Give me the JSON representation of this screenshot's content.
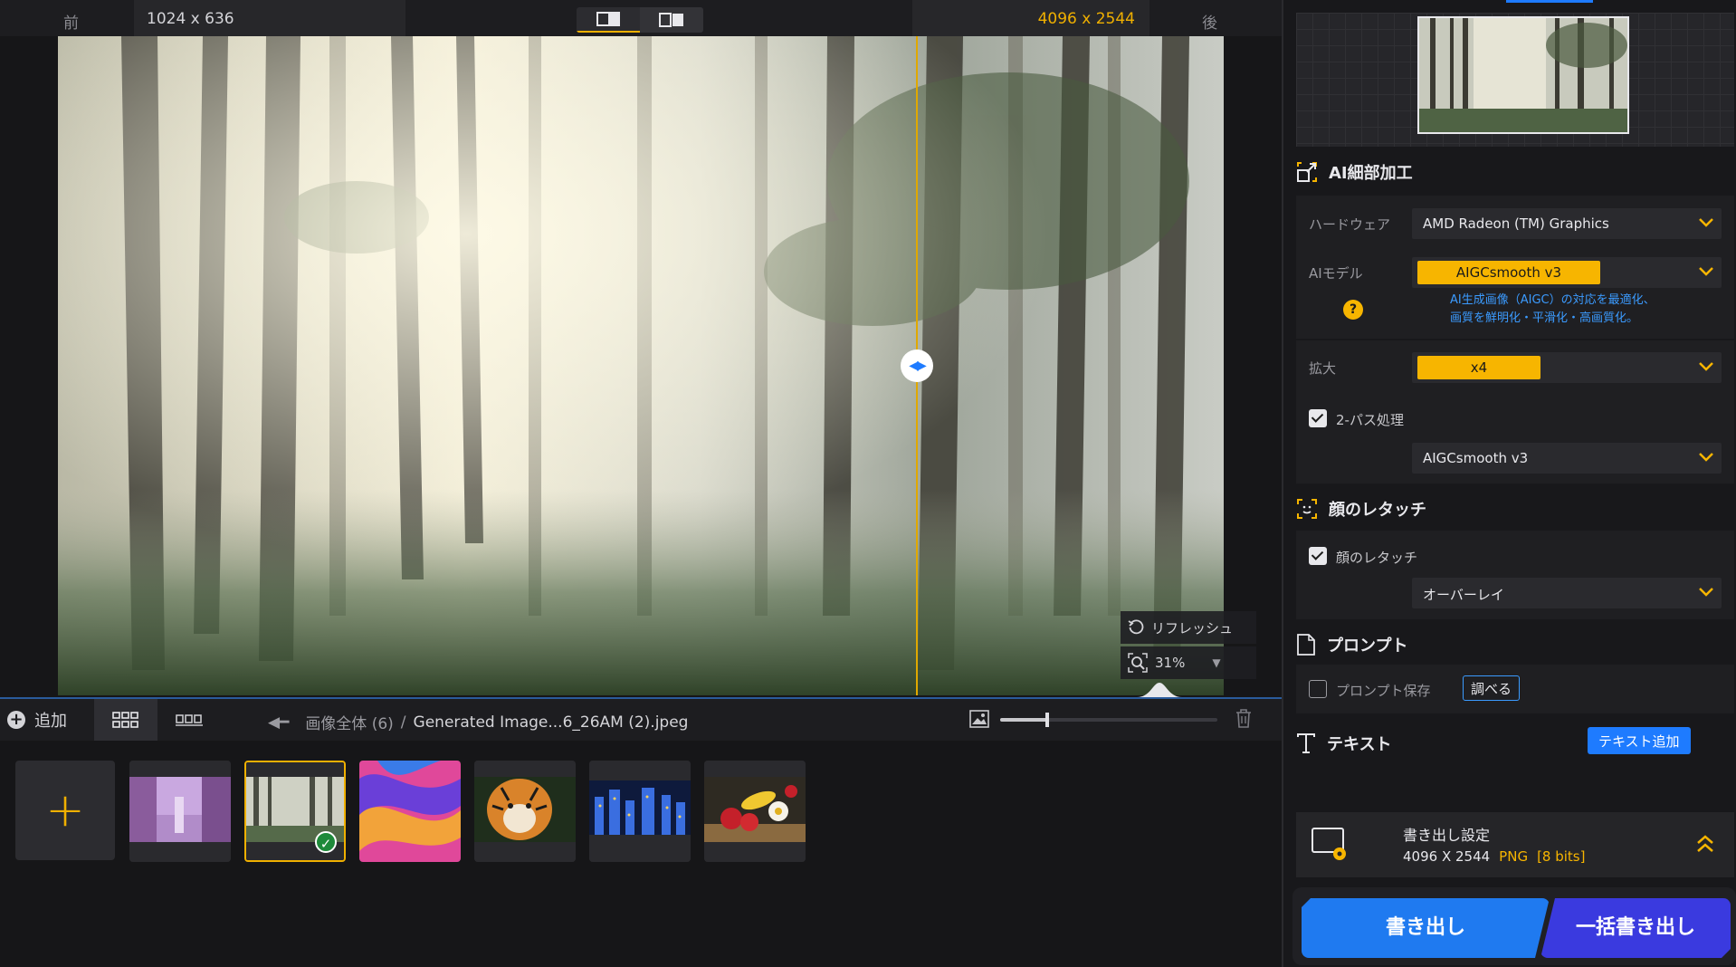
{
  "topbar": {
    "before_label": "前",
    "after_label": "後",
    "source_dims": "1024 x 636",
    "output_dims": "4096 x 2544"
  },
  "viewer": {
    "refresh_label": "リフレッシュ",
    "zoom_level": "31%"
  },
  "bottombar": {
    "add_label": "追加",
    "breadcrumb_root": "画像全体 (6)",
    "breadcrumb_sep": "/",
    "breadcrumb_file": "Generated Image...6_26AM (2).jpeg"
  },
  "thumbs": {
    "add_symbol": "+",
    "items": [
      {
        "name": "anime-city",
        "selected": false
      },
      {
        "name": "misty-forest",
        "selected": true
      },
      {
        "name": "abstract-waves",
        "selected": false
      },
      {
        "name": "tiger",
        "selected": false
      },
      {
        "name": "night-city",
        "selected": false
      },
      {
        "name": "fruit-flowers",
        "selected": false
      }
    ]
  },
  "panel": {
    "ai_section_title": "AI細部加工",
    "hardware_label": "ハードウェア",
    "hardware_value": "AMD Radeon (TM) Graphics",
    "ai_model_label": "AIモデル",
    "ai_model_value": "AIGCsmooth  v3",
    "ai_model_hint_line1": "AI生成画像（AIGC）の対応を最適化、",
    "ai_model_hint_line2": "画質を鮮明化・平滑化・高画質化。",
    "help_symbol": "?",
    "scale_label": "拡大",
    "scale_value": "x4",
    "twopass_label": "2-パス処理",
    "twopass_checked": true,
    "twopass_model_value": "AIGCsmooth  v3",
    "face_section_title": "顔のレタッチ",
    "face_check_label": "顔のレタッチ",
    "face_checked": true,
    "face_mode_value": "オーバーレイ",
    "prompt_section_title": "プロンプト",
    "prompt_save_label": "プロンプト保存",
    "prompt_save_checked": false,
    "examine_button": "調べる",
    "text_section_title": "テキスト",
    "add_text_button": "テキスト追加",
    "export_settings_title": "書き出し設定",
    "export_dims": "4096 X 2544",
    "export_format": "PNG",
    "export_bits": "[8 bits]",
    "export_button": "書き出し",
    "batch_export_button": "一括書き出し"
  },
  "colors": {
    "accent_yellow": "#f7b500",
    "accent_blue": "#1e7bff",
    "batch_purple": "#3a3adf"
  }
}
